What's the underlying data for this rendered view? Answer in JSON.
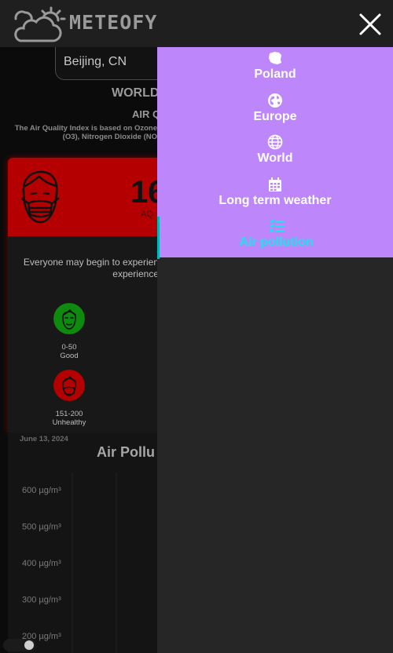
{
  "header": {
    "logo_text": "METEOFY"
  },
  "search": {
    "value": "Beijing, CN"
  },
  "main": {
    "title": "WORLD",
    "subtitle": "AIR Q",
    "aqi_description": "The Air Quality Index is based on Ozone (O3), Nitrogen Dioxide (NO"
  },
  "aqi_card": {
    "value": "16",
    "unit": "AQ",
    "message": "Everyone may begin to experien experience",
    "banner_color": "#b40000",
    "legend": [
      {
        "range": "0-50",
        "label": "Good",
        "color": "#0e8a0e"
      },
      {
        "range": "151-200",
        "label": "Unhealthy",
        "color": "#b40000"
      }
    ]
  },
  "chart": {
    "date": "June 13, 2024",
    "title": "Air Pollu"
  },
  "chart_data": {
    "type": "line",
    "title": "Air Pollu",
    "xlabel": "",
    "ylabel": "",
    "y_ticks": [
      "600 µg/m³",
      "500 µg/m³",
      "400 µg/m³",
      "300 µg/m³",
      "200 µg/m³"
    ],
    "ylim": [
      200,
      600
    ],
    "series": []
  },
  "nav_menu": {
    "bg_color": "#bd86fb",
    "active_color": "#19e6ea",
    "items": [
      {
        "label": "Poland",
        "icon": "poland-map-icon"
      },
      {
        "label": "Europe",
        "icon": "globe-europe-icon"
      },
      {
        "label": "World",
        "icon": "globe-icon"
      },
      {
        "label": "Long term weather",
        "icon": "calendar-icon"
      },
      {
        "label": "Air pollution",
        "icon": "list-icon"
      }
    ]
  }
}
